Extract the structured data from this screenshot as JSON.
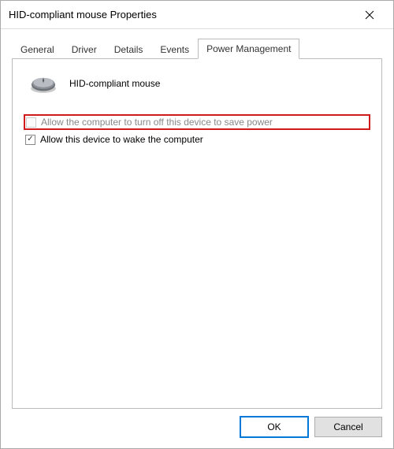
{
  "window": {
    "title": "HID-compliant mouse Properties"
  },
  "tabs": {
    "items": [
      {
        "label": "General"
      },
      {
        "label": "Driver"
      },
      {
        "label": "Details"
      },
      {
        "label": "Events"
      },
      {
        "label": "Power Management"
      }
    ],
    "active_index": 4
  },
  "device": {
    "name": "HID-compliant mouse",
    "icon": "mouse-icon"
  },
  "options": {
    "allow_turn_off": {
      "label": "Allow the computer to turn off this device to save power",
      "checked": false,
      "disabled": true,
      "highlighted": true
    },
    "allow_wake": {
      "label": "Allow this device to wake the computer",
      "checked": true,
      "disabled": false,
      "highlighted": false
    }
  },
  "buttons": {
    "ok": "OK",
    "cancel": "Cancel"
  },
  "colors": {
    "highlight": "#d11a1a",
    "primary": "#0078d7"
  }
}
